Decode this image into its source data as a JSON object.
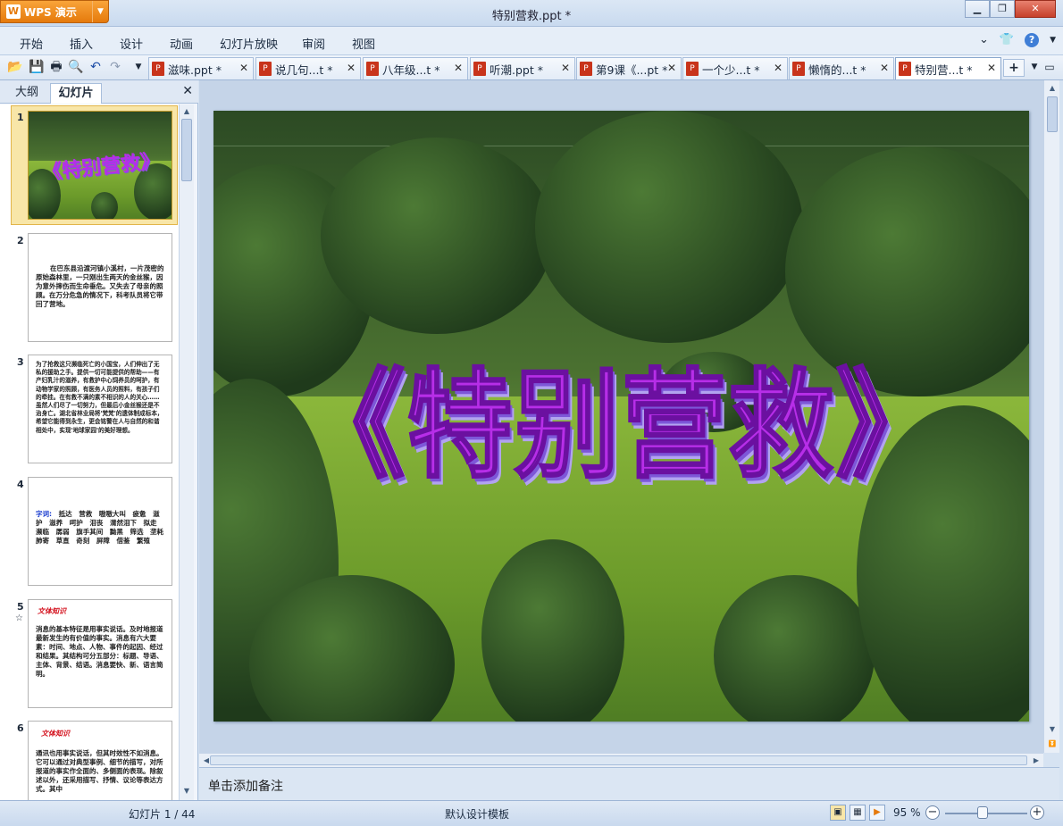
{
  "app": {
    "name": "WPS 演示",
    "window_title": "特别营救.ppt *"
  },
  "menu": [
    "开始",
    "插入",
    "设计",
    "动画",
    "幻灯片放映",
    "审阅",
    "视图"
  ],
  "tabs": [
    {
      "label": "滋味.ppt *"
    },
    {
      "label": "说几句...t *"
    },
    {
      "label": "八年级...t *"
    },
    {
      "label": "听潮.ppt *"
    },
    {
      "label": "第9课《...pt *"
    },
    {
      "label": "一个少...t *"
    },
    {
      "label": "懒惰的...t *"
    },
    {
      "label": "特别营...t *"
    }
  ],
  "panel": {
    "tab_outline": "大纲",
    "tab_slides": "幻灯片"
  },
  "thumbnails": [
    {
      "num": "1",
      "title": "《特别营救》"
    },
    {
      "num": "2",
      "text": "在巴东县沿渡河镇小溪村，一片茂密的原始森林里，一只刚出生两天的金丝猴，因为意外摔伤而生命垂危。又失去了母亲的照顾。在万分危急的情况下，科考队员将它带回了营地。"
    },
    {
      "num": "3",
      "text": "为了抢救这只濒临死亡的小国宝，人们伸出了无私的援助之手。提供一切可能提供的帮助——有产妇乳汁的滋养，有救护中心饲养员的呵护，有动物学家的照顾，有医务人员的照料，有孩子们的牵挂。在有救不满的素不相识的人的关心……虽然人们尽了一切努力，但最后小金丝猴还是不治身亡。湖北省林业局将'梵梵'的遗体制成标本，希望它能得到永生，更会铭警在人与自然的和谐相处中，实现'地球家园'的美好理想。"
    },
    {
      "num": "4",
      "label": "字词:",
      "text": "抵达 营救 嗷嗷大叫 疲惫 滋护 滋养 呵护 泪丧 潸然泪下 拟走 濒临 孱弱 旗手其间 黝黑 筛选 垄耗 肺寄 草直 奇刻 屏障 借鉴 繁殖"
    },
    {
      "num": "5",
      "heading": "文体知识",
      "text": "消息的基本特征是用事实说话。及时地报道最新发生的有价值的事实。消息有六大要素：时间、地点、人物、事件的起因、经过和结果。其结构可分五部分：标题、导语、主体、背景、结语。消息要快、新、语言简明。"
    },
    {
      "num": "6",
      "heading": "文体知识",
      "text": "通讯也用事实说话，但其时效性不如消息。它可以通过对典型事例、细节的描写，对所报道的事实作全面的、多侧面的表现。除叙述以外，还采用描写、抒情、议论等表达方式。其中"
    }
  ],
  "slide": {
    "title": "《特别营救》"
  },
  "notes_placeholder": "单击添加备注",
  "status": {
    "slide_counter": "幻灯片 1 / 44",
    "template": "默认设计模板",
    "zoom": "95 %"
  }
}
